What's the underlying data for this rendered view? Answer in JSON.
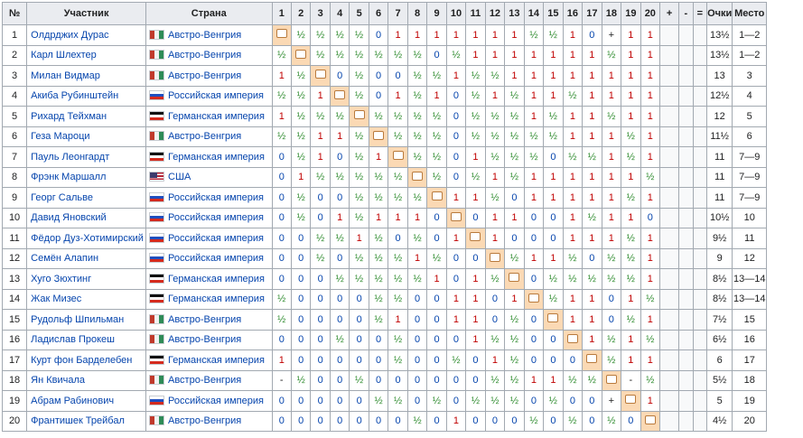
{
  "headers": {
    "no": "№",
    "player": "Участник",
    "country": "Страна",
    "rounds": [
      "1",
      "2",
      "3",
      "4",
      "5",
      "6",
      "7",
      "8",
      "9",
      "10",
      "11",
      "12",
      "13",
      "14",
      "15",
      "16",
      "17",
      "18",
      "19",
      "20"
    ],
    "plus": "+",
    "minus": "-",
    "eq": "=",
    "points": "Очки",
    "place": "Место"
  },
  "rows": [
    {
      "no": "1",
      "name": "Олдрджих Дурас",
      "flag": "ah",
      "country": "Австро-Венгрия",
      "results": [
        "*",
        "½",
        "½",
        "½",
        "½",
        "0",
        "1",
        "1",
        "1",
        "1",
        "1",
        "1",
        "1",
        "½",
        "½",
        "1",
        "0",
        "+",
        "1",
        "1"
      ],
      "points": "13½",
      "place": "1—2"
    },
    {
      "no": "2",
      "name": "Карл Шлехтер",
      "flag": "ah",
      "country": "Австро-Венгрия",
      "results": [
        "½",
        "*",
        "½",
        "½",
        "½",
        "½",
        "½",
        "½",
        "0",
        "½",
        "1",
        "1",
        "1",
        "1",
        "1",
        "1",
        "1",
        "½",
        "1",
        "1"
      ],
      "points": "13½",
      "place": "1—2"
    },
    {
      "no": "3",
      "name": "Милан Видмар",
      "flag": "ah",
      "country": "Австро-Венгрия",
      "results": [
        "1",
        "½",
        "*",
        "0",
        "½",
        "0",
        "0",
        "½",
        "½",
        "1",
        "½",
        "½",
        "1",
        "1",
        "1",
        "1",
        "1",
        "1",
        "1",
        "1"
      ],
      "points": "13",
      "place": "3"
    },
    {
      "no": "4",
      "name": "Акиба Рубинштейн",
      "flag": "ru",
      "country": "Российская империя",
      "results": [
        "½",
        "½",
        "1",
        "*",
        "½",
        "0",
        "1",
        "½",
        "1",
        "0",
        "½",
        "1",
        "½",
        "1",
        "1",
        "½",
        "1",
        "1",
        "1",
        "1"
      ],
      "points": "12½",
      "place": "4"
    },
    {
      "no": "5",
      "name": "Рихард Тейхман",
      "flag": "de",
      "country": "Германская империя",
      "results": [
        "1",
        "½",
        "½",
        "½",
        "*",
        "½",
        "½",
        "½",
        "½",
        "0",
        "½",
        "½",
        "½",
        "1",
        "½",
        "1",
        "1",
        "½",
        "1",
        "1"
      ],
      "points": "12",
      "place": "5"
    },
    {
      "no": "6",
      "name": "Геза Мароци",
      "flag": "ah",
      "country": "Австро-Венгрия",
      "results": [
        "½",
        "½",
        "1",
        "1",
        "½",
        "*",
        "½",
        "½",
        "½",
        "0",
        "½",
        "½",
        "½",
        "½",
        "½",
        "1",
        "1",
        "1",
        "½",
        "1"
      ],
      "points": "11½",
      "place": "6"
    },
    {
      "no": "7",
      "name": "Пауль Леонгардт",
      "flag": "de",
      "country": "Германская империя",
      "results": [
        "0",
        "½",
        "1",
        "0",
        "½",
        "1",
        "*",
        "½",
        "½",
        "0",
        "1",
        "½",
        "½",
        "½",
        "0",
        "½",
        "½",
        "1",
        "½",
        "1"
      ],
      "points": "11",
      "place": "7—9"
    },
    {
      "no": "8",
      "name": "Фрэнк Маршалл",
      "flag": "us",
      "country": "США",
      "results": [
        "0",
        "1",
        "½",
        "½",
        "½",
        "½",
        "½",
        "*",
        "½",
        "0",
        "½",
        "1",
        "½",
        "1",
        "1",
        "1",
        "1",
        "1",
        "1",
        "½"
      ],
      "points": "11",
      "place": "7—9"
    },
    {
      "no": "9",
      "name": "Георг Сальве",
      "flag": "ru",
      "country": "Российская империя",
      "results": [
        "0",
        "½",
        "0",
        "0",
        "½",
        "½",
        "½",
        "½",
        "*",
        "1",
        "1",
        "½",
        "0",
        "1",
        "1",
        "1",
        "1",
        "1",
        "½",
        "1"
      ],
      "points": "11",
      "place": "7—9"
    },
    {
      "no": "10",
      "name": "Давид Яновский",
      "flag": "ru",
      "country": "Российская империя",
      "results": [
        "0",
        "½",
        "0",
        "1",
        "½",
        "1",
        "1",
        "1",
        "0",
        "*",
        "0",
        "1",
        "1",
        "0",
        "0",
        "1",
        "½",
        "1",
        "1",
        "0"
      ],
      "points": "10½",
      "place": "10"
    },
    {
      "no": "11",
      "name": "Фёдор Дуз-Хотимирский",
      "flag": "ru",
      "country": "Российская империя",
      "results": [
        "0",
        "0",
        "½",
        "½",
        "1",
        "½",
        "0",
        "½",
        "0",
        "1",
        "*",
        "1",
        "0",
        "0",
        "0",
        "1",
        "1",
        "1",
        "½",
        "1"
      ],
      "points": "9½",
      "place": "11"
    },
    {
      "no": "12",
      "name": "Семён Алапин",
      "flag": "ru",
      "country": "Российская империя",
      "results": [
        "0",
        "0",
        "½",
        "0",
        "½",
        "½",
        "½",
        "1",
        "½",
        "0",
        "0",
        "*",
        "½",
        "1",
        "1",
        "½",
        "0",
        "½",
        "½",
        "1"
      ],
      "points": "9",
      "place": "12"
    },
    {
      "no": "13",
      "name": "Хуго Зюхтинг",
      "flag": "de",
      "country": "Германская империя",
      "results": [
        "0",
        "0",
        "0",
        "½",
        "½",
        "½",
        "½",
        "½",
        "1",
        "0",
        "1",
        "½",
        "*",
        "0",
        "½",
        "½",
        "½",
        "½",
        "½",
        "1"
      ],
      "points": "8½",
      "place": "13—14"
    },
    {
      "no": "14",
      "name": "Жак Мизес",
      "flag": "de",
      "country": "Германская империя",
      "results": [
        "½",
        "0",
        "0",
        "0",
        "0",
        "½",
        "½",
        "0",
        "0",
        "1",
        "1",
        "0",
        "1",
        "*",
        "½",
        "1",
        "1",
        "0",
        "1",
        "½"
      ],
      "points": "8½",
      "place": "13—14"
    },
    {
      "no": "15",
      "name": "Рудольф Шпильман",
      "flag": "ah",
      "country": "Австро-Венгрия",
      "results": [
        "½",
        "0",
        "0",
        "0",
        "0",
        "½",
        "1",
        "0",
        "0",
        "1",
        "1",
        "0",
        "½",
        "0",
        "*",
        "1",
        "1",
        "0",
        "½",
        "1"
      ],
      "points": "7½",
      "place": "15"
    },
    {
      "no": "16",
      "name": "Ладислав Прокеш",
      "flag": "ah",
      "country": "Австро-Венгрия",
      "results": [
        "0",
        "0",
        "0",
        "½",
        "0",
        "0",
        "½",
        "0",
        "0",
        "0",
        "1",
        "½",
        "½",
        "0",
        "0",
        "*",
        "1",
        "½",
        "1",
        "½"
      ],
      "points": "6½",
      "place": "16"
    },
    {
      "no": "17",
      "name": "Курт фон Барделебен",
      "flag": "de",
      "country": "Германская империя",
      "results": [
        "1",
        "0",
        "0",
        "0",
        "0",
        "0",
        "½",
        "0",
        "0",
        "½",
        "0",
        "1",
        "½",
        "0",
        "0",
        "0",
        "*",
        "½",
        "1",
        "1"
      ],
      "points": "6",
      "place": "17"
    },
    {
      "no": "18",
      "name": "Ян Квичала",
      "flag": "ah",
      "country": "Австро-Венгрия",
      "results": [
        "-",
        "½",
        "0",
        "0",
        "½",
        "0",
        "0",
        "0",
        "0",
        "0",
        "0",
        "½",
        "½",
        "1",
        "1",
        "½",
        "½",
        "*",
        "-",
        "½"
      ],
      "points": "5½",
      "place": "18"
    },
    {
      "no": "19",
      "name": "Абрам Рабинович",
      "flag": "ru",
      "country": "Российская империя",
      "results": [
        "0",
        "0",
        "0",
        "0",
        "0",
        "½",
        "½",
        "0",
        "½",
        "0",
        "½",
        "½",
        "½",
        "0",
        "½",
        "0",
        "0",
        "+",
        "*",
        "1"
      ],
      "points": "5",
      "place": "19"
    },
    {
      "no": "20",
      "name": "Франтишек Трейбал",
      "flag": "ah",
      "country": "Австро-Венгрия",
      "results": [
        "0",
        "0",
        "0",
        "0",
        "0",
        "0",
        "0",
        "½",
        "0",
        "1",
        "0",
        "0",
        "0",
        "½",
        "0",
        "½",
        "0",
        "½",
        "0",
        "*"
      ],
      "points": "4½",
      "place": "20"
    }
  ],
  "colors": {
    "win": "#c00000",
    "loss": "#0645ad",
    "draw": "#2c8a2c",
    "self": "#fbd9b4",
    "header": "#eaecf0",
    "border": "#a2a9b1"
  }
}
